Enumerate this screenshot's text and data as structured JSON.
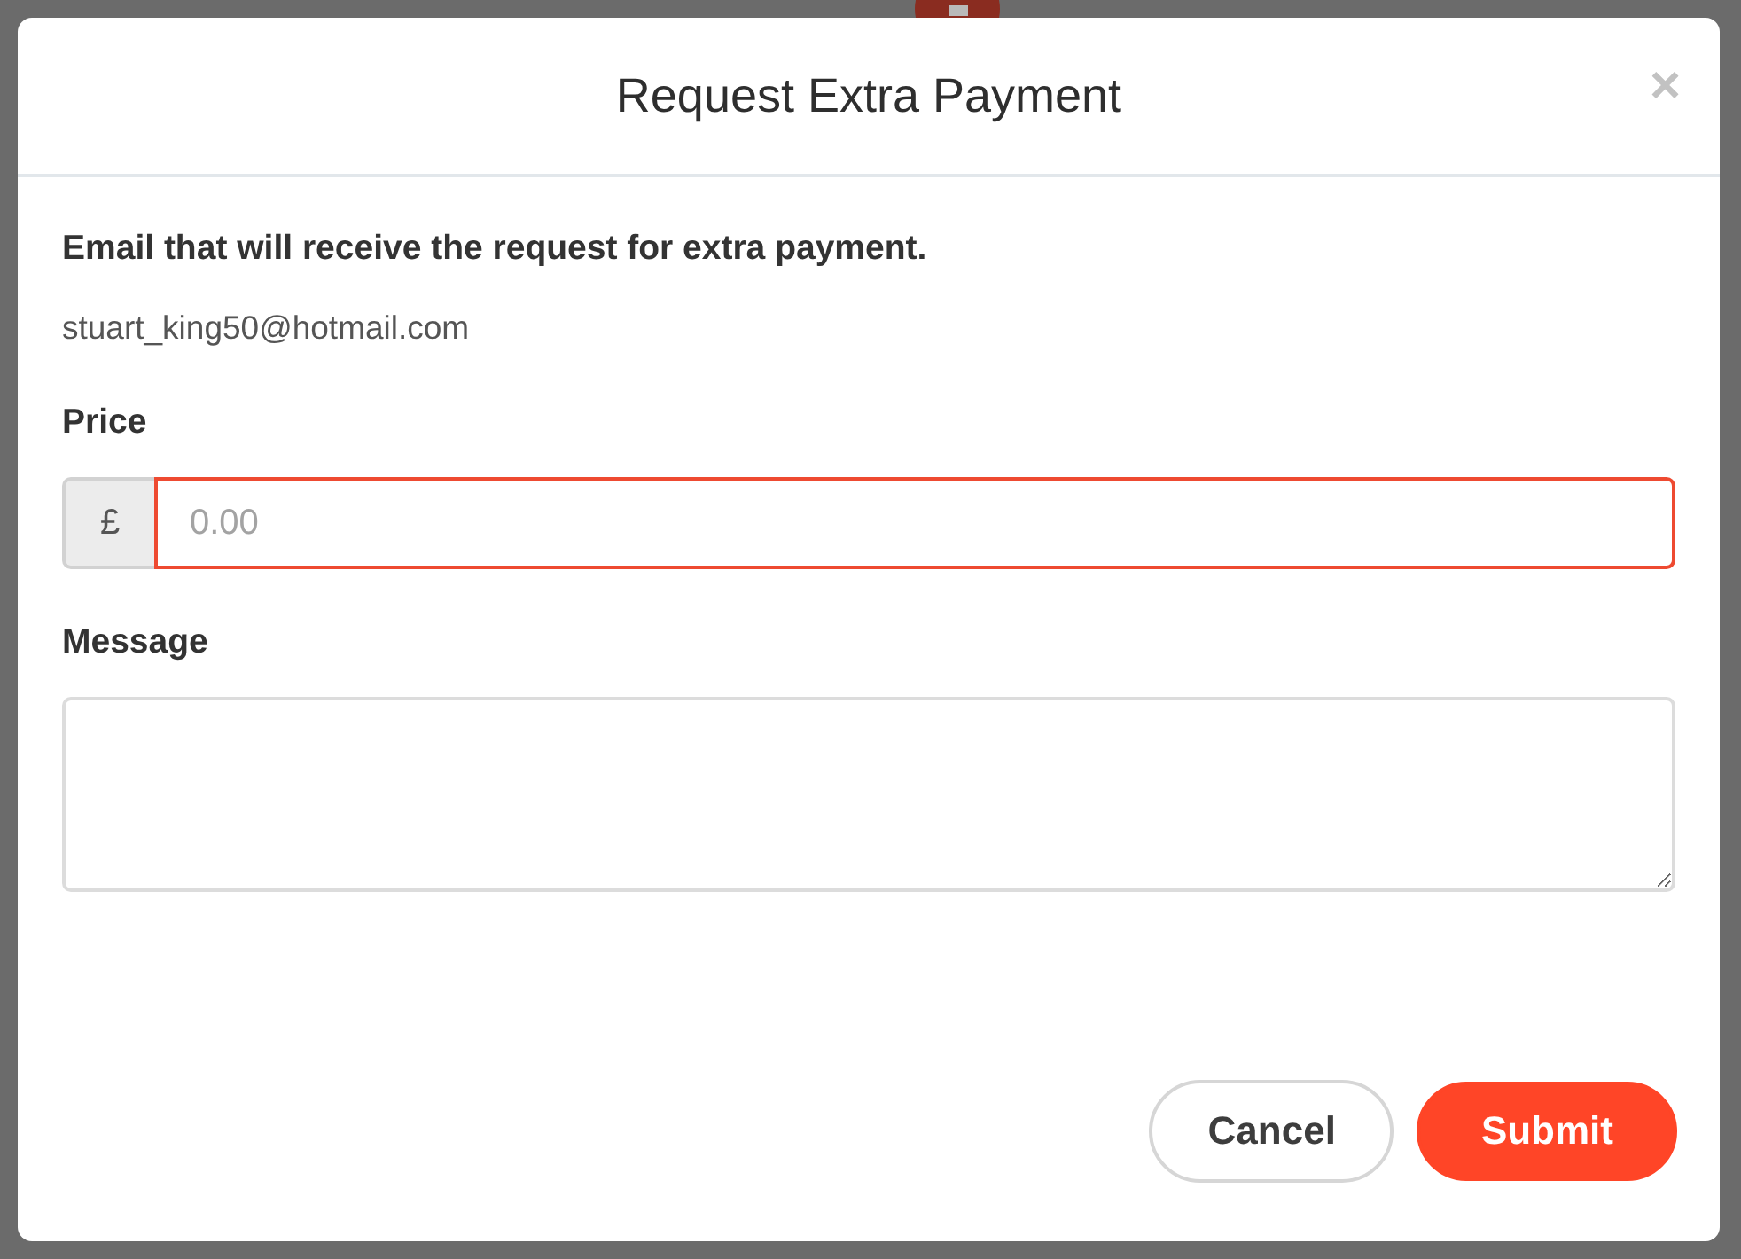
{
  "dialog": {
    "title": "Request Extra Payment",
    "close": "×"
  },
  "email": {
    "label": "Email that will receive the request for extra payment.",
    "value": "stuart_king50@hotmail.com"
  },
  "price": {
    "label": "Price",
    "currency": "£",
    "placeholder": "0.00",
    "invalid": true
  },
  "message": {
    "label": "Message"
  },
  "buttons": [
    {
      "label": "Cancel",
      "kind": "secondary"
    },
    {
      "label": "Submit",
      "kind": "primary"
    }
  ]
}
